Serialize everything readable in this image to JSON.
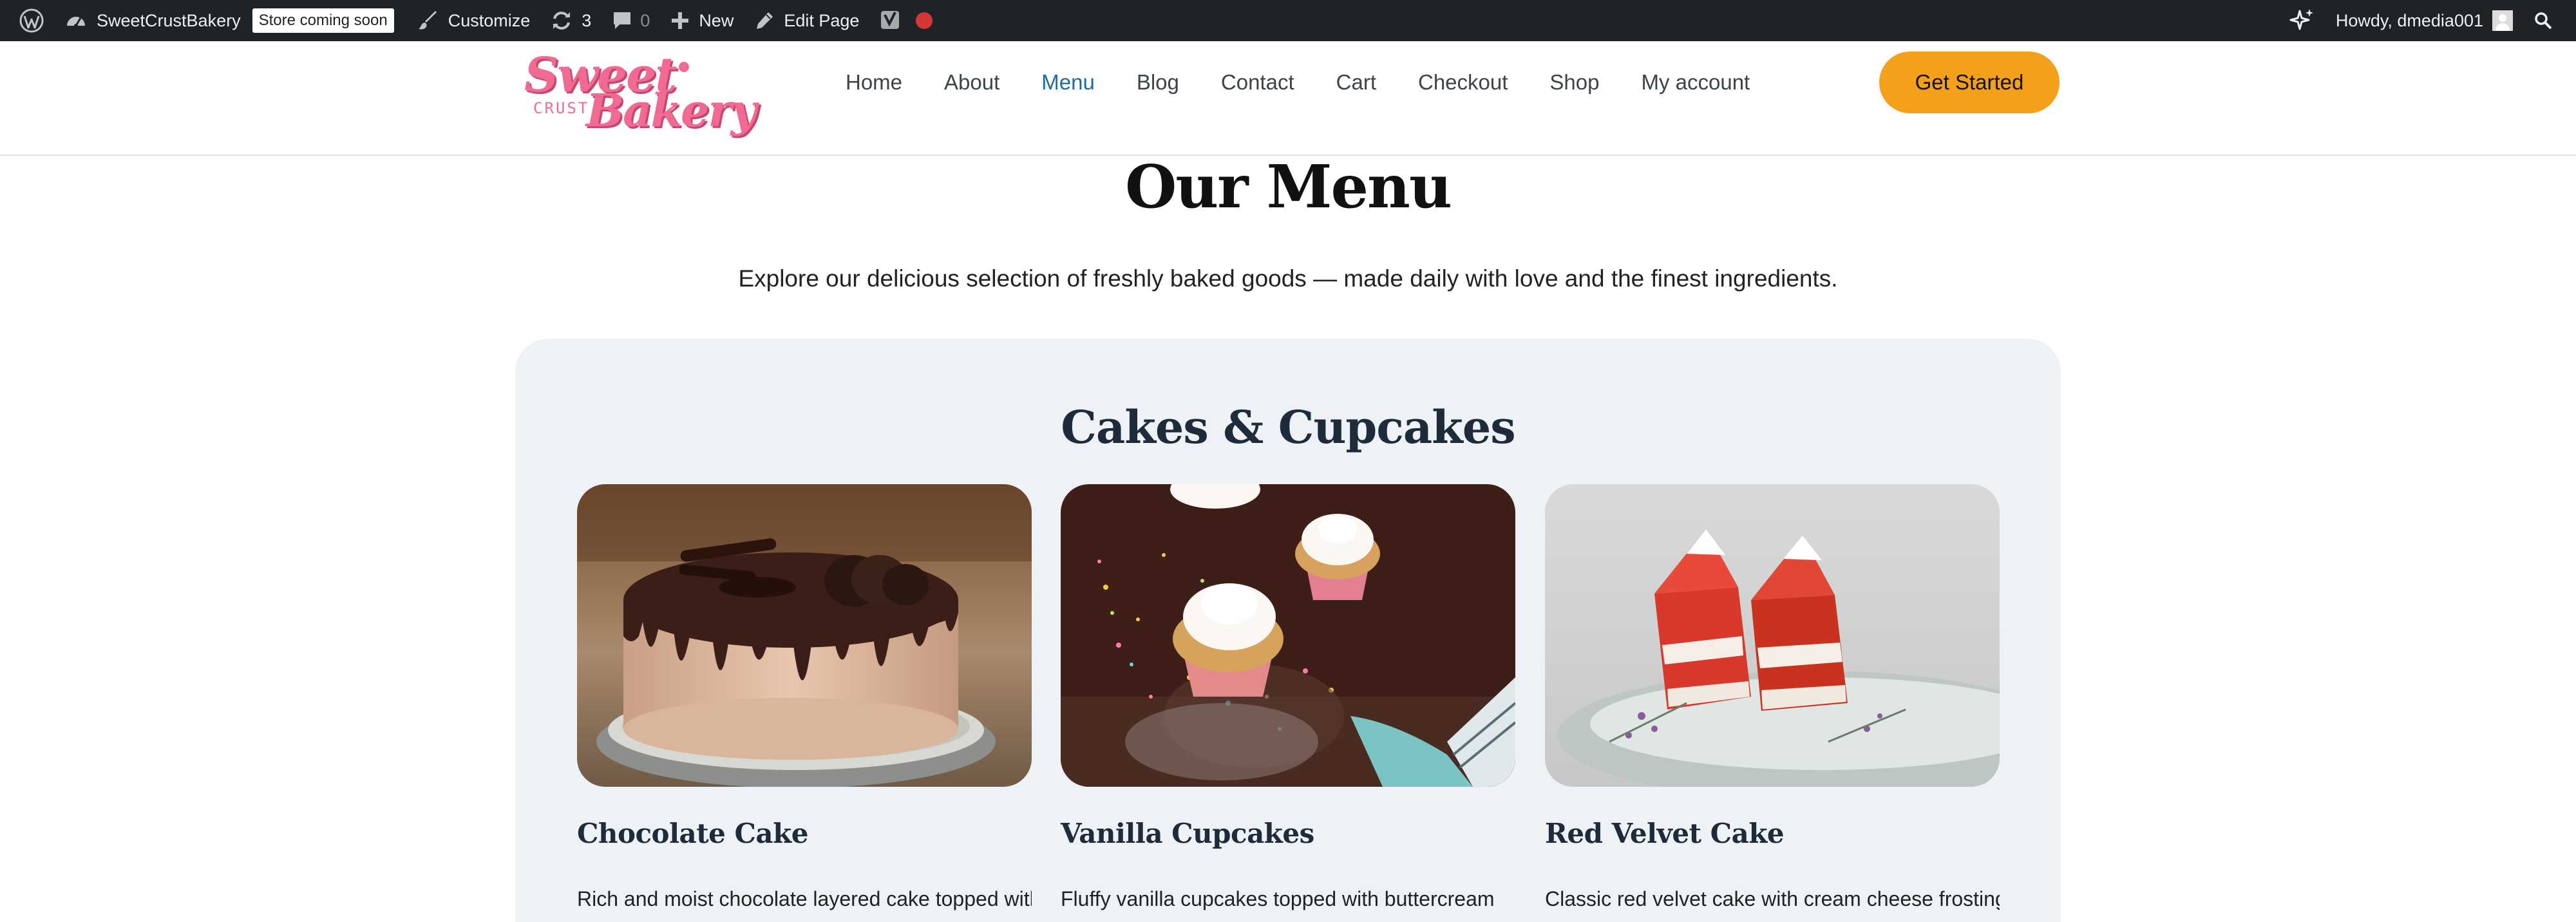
{
  "admin_bar": {
    "site_name": "SweetCrustBakery",
    "store_badge": "Store coming soon",
    "customize": "Customize",
    "updates_count": "3",
    "comments_count": "0",
    "new": "New",
    "edit_page": "Edit Page",
    "greeting": "Howdy, dmedia001",
    "icons": [
      "wordpress-logo-icon",
      "dashboard-icon",
      "brush-icon",
      "updates-icon",
      "comment-icon",
      "plus-icon",
      "pencil-icon",
      "yoast-icon",
      "seo-status-dot",
      "sparkle-icon",
      "avatar",
      "search-icon"
    ],
    "colors": {
      "bar": "#1d2327",
      "status_dot": "#d63638"
    }
  },
  "header": {
    "logo": {
      "top": "Sweet",
      "middle": "CRUST",
      "bottom": "Bakery"
    },
    "nav": [
      "Home",
      "About",
      "Menu",
      "Blog",
      "Contact",
      "Cart",
      "Checkout",
      "Shop",
      "My account"
    ],
    "active_nav": "Menu",
    "cta": "Get Started",
    "colors": {
      "active": "#1e6b9e",
      "cta": "#f5a01a",
      "logo": "#f06a92"
    }
  },
  "main": {
    "title": "Our Menu",
    "intro": "Explore our delicious selection of freshly baked goods — made daily with love and the finest ingredients.",
    "section": {
      "title": "Cakes & Cupcakes",
      "items": [
        {
          "name": "Chocolate Cake",
          "description": "Rich and moist chocolate layered cake topped with"
        },
        {
          "name": "Vanilla Cupcakes",
          "description": "Fluffy vanilla cupcakes topped with buttercream"
        },
        {
          "name": "Red Velvet Cake",
          "description": "Classic red velvet cake with cream cheese frosting."
        }
      ]
    }
  }
}
